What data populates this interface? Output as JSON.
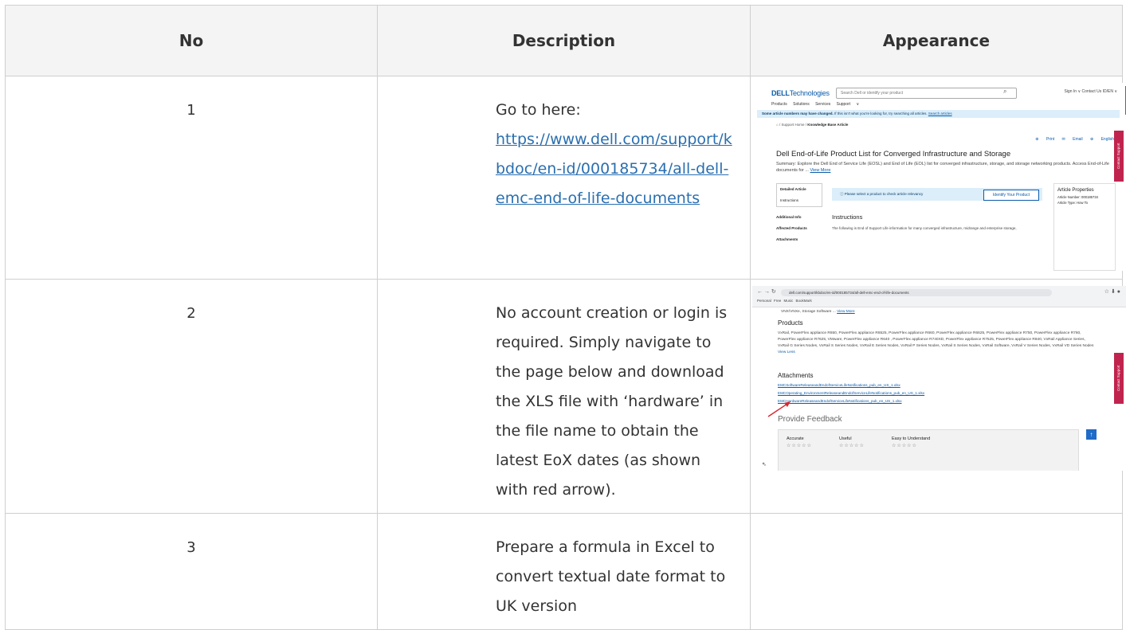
{
  "table": {
    "headers": [
      "No",
      "Description",
      "Appearance"
    ],
    "rows": [
      {
        "no": "1",
        "desc_prefix": "Go to here:",
        "link": "https://www.dell.com/support/kbdoc/en-id/000185734/all-dell-emc-end-of-life-documents"
      },
      {
        "no": "2",
        "desc": "No account creation or login is required. Simply navigate to the page below and download the XLS file with ‘hardware’ in the file name to obtain the latest EoX dates (as shown with red arrow)."
      },
      {
        "no": "3",
        "desc": "Prepare a formula in Excel to convert textual date format to UK version"
      }
    ]
  },
  "shot1": {
    "logo_bold": "DELL",
    "logo_rest": "Technologies",
    "search_placeholder": "Search Dell or identify your product",
    "top_right": "Sign In ∨   Contact Us   ID/EN ∨",
    "nav": "Products  Solutions  Services  Support ∨",
    "banner_bold": "Some article numbers may have changed.",
    "banner_text": " If this isn't what you're looking for, try searching all articles. ",
    "banner_link": "Search articles",
    "crumb_1": "⌂ / Support Home / ",
    "crumb_2": "Knowledge Base Article",
    "actions": "⊕ Print  ✉ Email  ⊕ English",
    "title": "Dell End-of-Life Product List for Converged Infrastructure and Storage",
    "summary": "Summary: Explore the Dell End of Service Life (EOSL) and End of Life (EOL) list for converged infrastructure, storage, and storage networking products. Access End-of-Life documents for ... ",
    "summary_link": "View More",
    "nav_detailed": "Detailed Article",
    "nav_instructions": "Instructions",
    "nav_additional": "Additional Info",
    "nav_affected": "Affected Products",
    "nav_attachments": "Attachments",
    "select_msg": "ⓘ Please select a product to check article relevancy",
    "identify_btn": "Identify Your Product",
    "props_title": "Article Properties",
    "props_number": "Article Number: 000185734",
    "props_type": "Article Type: How To",
    "instructions": "Instructions",
    "instructions_text": "The following is End of Support Life information for many converged infrastructure, midrange and enterprise storage,",
    "contact": "Contact Support"
  },
  "shot2": {
    "url": "dell.com/support/kbdoc/en-id/000185734/all-dell-emc-end-of-life-documents",
    "bookmarks": "Personal   Free Music   BookMark",
    "crumb": "VNX/VNXe, Storage Software ... ",
    "crumb_link": "View More",
    "products_head": "Products",
    "products_text": "VxRail, PowerFlex appliance R650, PowerFlex appliance R6525, PowerFlex appliance R660, PowerFlex appliance R6625, PowerFlex appliance R750, PowerFlex appliance R760, PowerFlex appliance R7625, VMware, PowerFlex appliance R640 , PowerFlex appliance R740XD, PowerFlex appliance R7525, PowerFlex appliance R840, VxRail Appliance Series, VxRail G Series Nodes, VxRail S Series Nodes, VxRail E Series Nodes, VxRail P Series Nodes, VxRail S Series Nodes, VxRail Software, VxRail V Series Nodes, VxRail VD Series Nodes ",
    "products_link": "View Less",
    "attachments_head": "Attachments",
    "att1": "EMCSoftwareReleaseandEndofServiceLifeNotifications_pub_en_US_1.xlsx",
    "att2": "EMCOperating_EnvironmentReleaseandEndofServiceLifeNotifications_pub_en_US_1.xlsx",
    "att3": "EMCHardwareReleaseandEndofServiceLifeNotifications_pub_en_US_1.xlsx",
    "feedback": "Provide Feedback",
    "r_accurate": "Accurate",
    "r_useful": "Useful",
    "r_easy": "Easy to Understand",
    "stars": "☆☆☆☆☆",
    "contact": "Contact Support",
    "up": "↑",
    "accent_arrow": "#d9262c"
  }
}
